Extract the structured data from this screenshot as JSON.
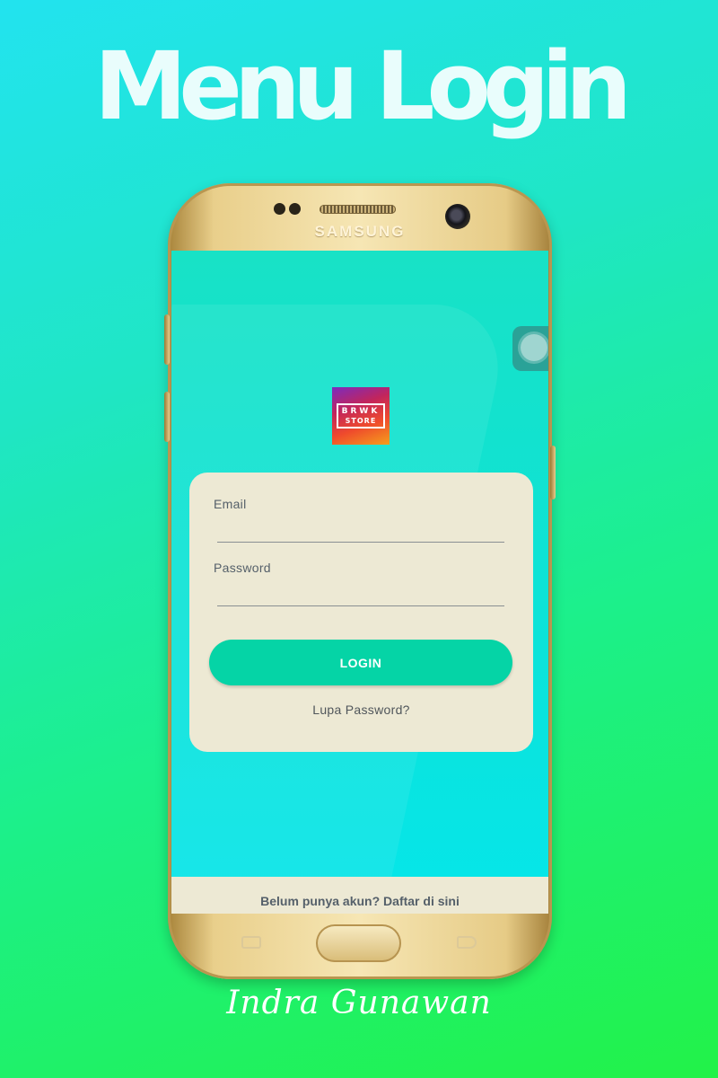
{
  "headline": "Menu Login",
  "phone": {
    "brand": "SAMSUNG"
  },
  "app": {
    "logo": {
      "line1": "BRWK",
      "line2": "STORE"
    },
    "form": {
      "email_label": "Email",
      "email_value": "",
      "password_label": "Password",
      "password_value": "",
      "login_button": "LOGIN",
      "forgot_link": "Lupa Password?"
    },
    "register_link": "Belum punya akun? Daftar di sini"
  },
  "signature": "Indra Gunawan",
  "colors": {
    "accent": "#05d4a6",
    "screen_bg": "#0ce3d9",
    "card_bg": "#ede9d4",
    "phone_frame": "#e9cf8b"
  }
}
